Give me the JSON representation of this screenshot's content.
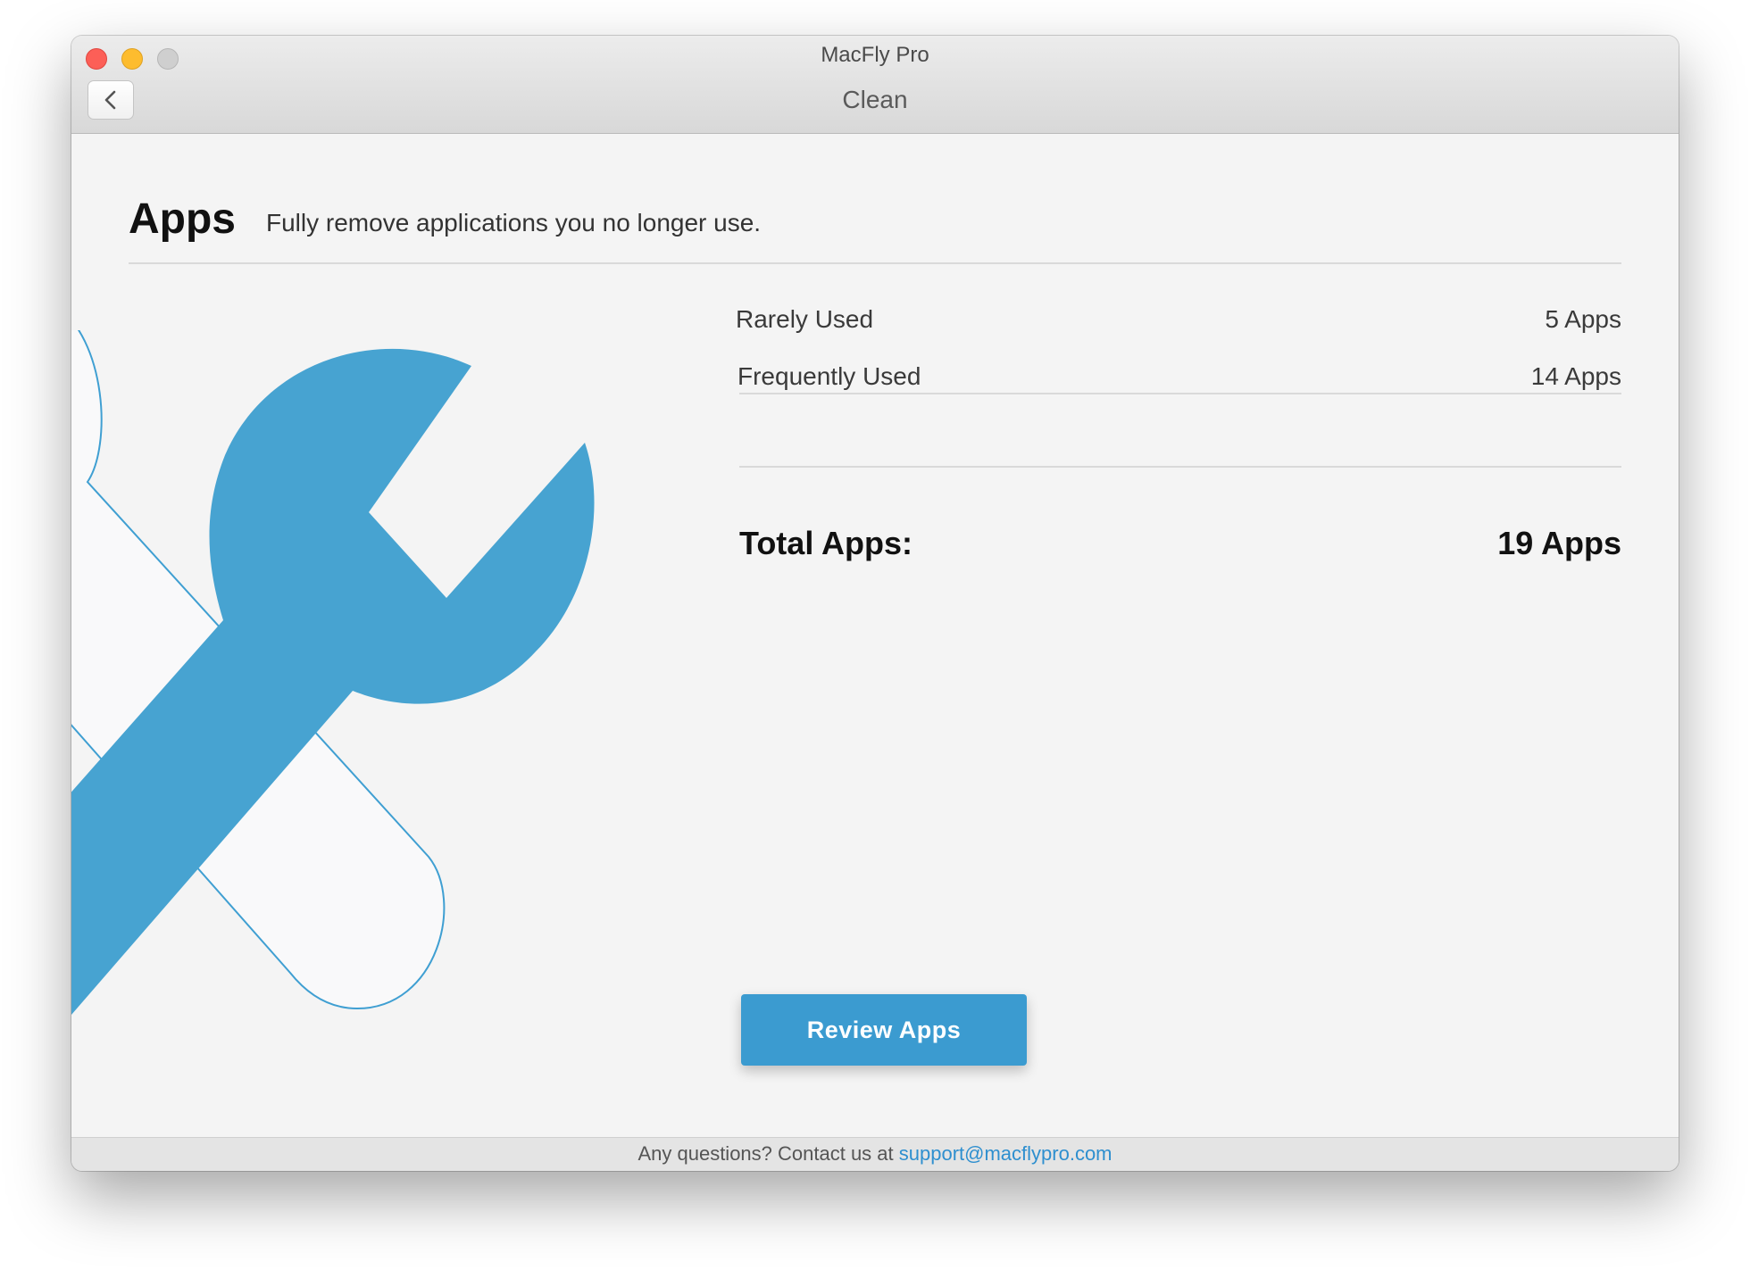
{
  "window": {
    "app_title": "MacFly Pro",
    "section_title": "Clean"
  },
  "header": {
    "title": "Apps",
    "subtitle": "Fully remove applications you no longer use."
  },
  "stats": {
    "rows": [
      {
        "label": "Rarely Used",
        "value": "5 Apps"
      },
      {
        "label": "Frequently Used",
        "value": "14 Apps"
      }
    ],
    "total": {
      "label": "Total Apps:",
      "value": "19 Apps"
    }
  },
  "actions": {
    "review_label": "Review Apps"
  },
  "footer": {
    "text": "Any questions? Contact us at ",
    "email": "support@macflypro.com"
  },
  "icons": {
    "back": "chevron-left-icon",
    "illustration": "wrench-icon"
  },
  "colors": {
    "accent": "#3b9bd0",
    "link": "#2e8fcf",
    "close": "#fc5f57",
    "minimize": "#fdbc2e",
    "maximize": "#cfcfcf"
  }
}
